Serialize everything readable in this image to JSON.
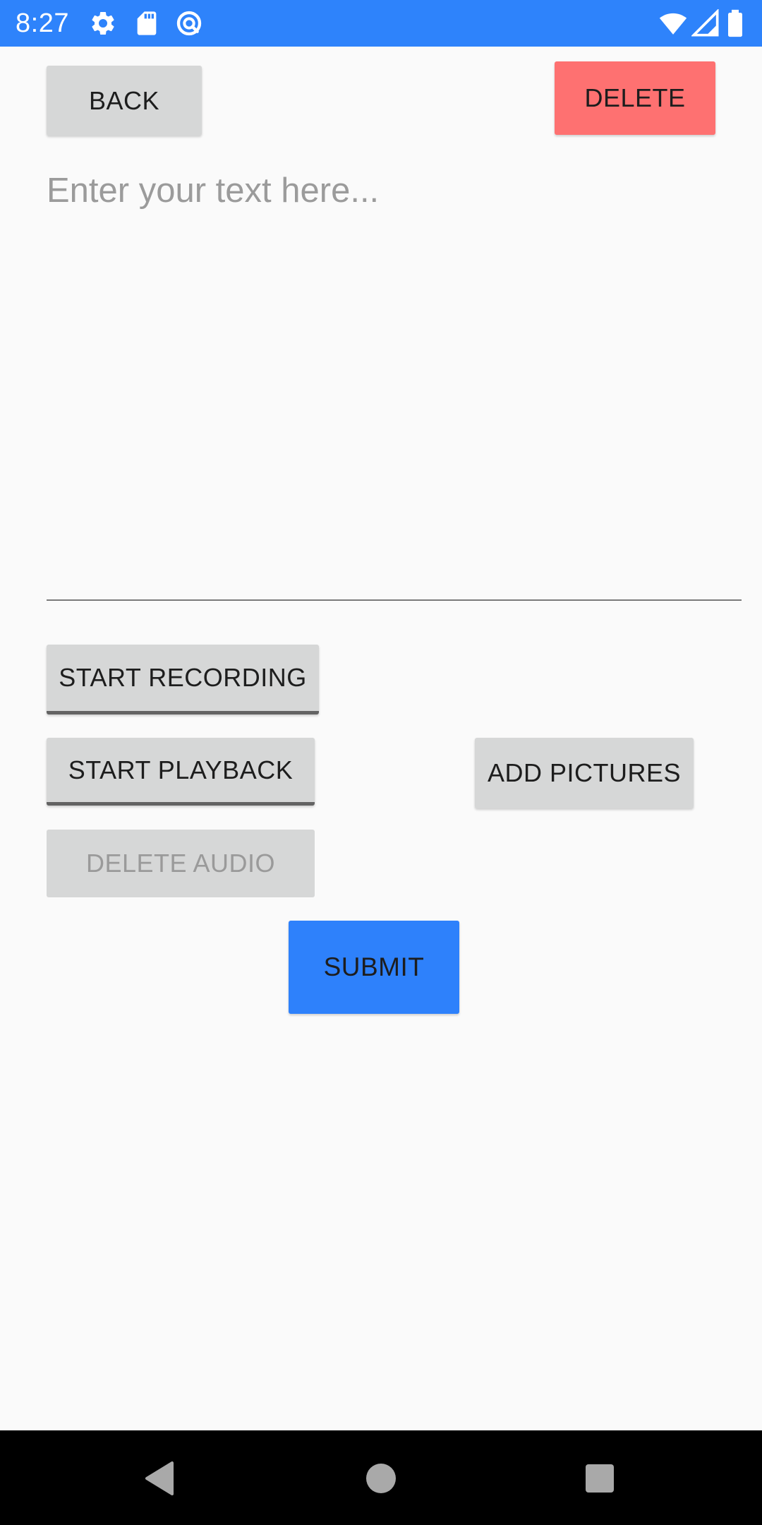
{
  "status_bar": {
    "time": "8:27",
    "background_color": "#2e83fb",
    "left_icons": [
      "gear-icon",
      "sd-card-icon",
      "circle-slash-icon"
    ],
    "right_icons": [
      "wifi-icon",
      "cell-signal-icon",
      "battery-icon"
    ]
  },
  "header": {
    "back_label": "BACK",
    "delete_label": "DELETE",
    "delete_color": "#fe7171"
  },
  "editor": {
    "placeholder": "Enter your text here...",
    "value": ""
  },
  "audio": {
    "start_recording_label": "START RECORDING",
    "start_playback_label": "START PLAYBACK",
    "delete_audio_label": "DELETE AUDIO",
    "delete_audio_enabled": false
  },
  "pictures": {
    "add_pictures_label": "ADD PICTURES"
  },
  "submit": {
    "label": "SUBMIT",
    "color": "#2e81fb"
  },
  "nav_bar": {
    "icons": [
      "back-triangle-icon",
      "home-circle-icon",
      "recents-square-icon"
    ]
  }
}
